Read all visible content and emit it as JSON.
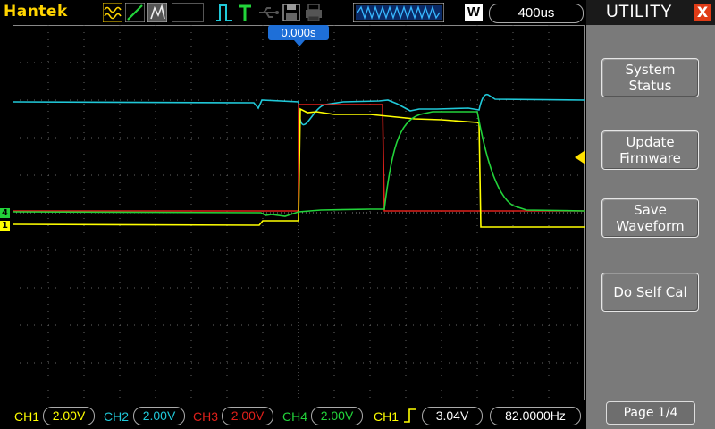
{
  "brand": "Hantek",
  "timebase": "400us",
  "zoom_mode": "W",
  "trigger_time": "0.000s",
  "channels": [
    {
      "label": "CH1",
      "value": "2.00V",
      "color": "#ffff00"
    },
    {
      "label": "CH2",
      "value": "2.00V",
      "color": "#20c8d8"
    },
    {
      "label": "CH3",
      "value": "2.00V",
      "color": "#e0201a"
    },
    {
      "label": "CH4",
      "value": "2.00V",
      "color": "#22d33a"
    }
  ],
  "trigger": {
    "source": "CH1",
    "level": "3.04V",
    "frequency": "82.0000Hz"
  },
  "markers": {
    "ch4": "4",
    "ch1": "1"
  },
  "menu": {
    "title": "UTILITY",
    "close": "X",
    "buttons": [
      "System\nStatus",
      "Update\nFirmware",
      "Save\nWaveform",
      "Do Self Cal"
    ],
    "page": "Page 1/4"
  },
  "icons": [
    "waveform-icon",
    "ramp-icon",
    "persistence-icon",
    "pulse-icon",
    "trigger-t-icon",
    "usb-icon",
    "save-disk-icon",
    "printer-icon",
    "memory-depth-icon"
  ]
}
